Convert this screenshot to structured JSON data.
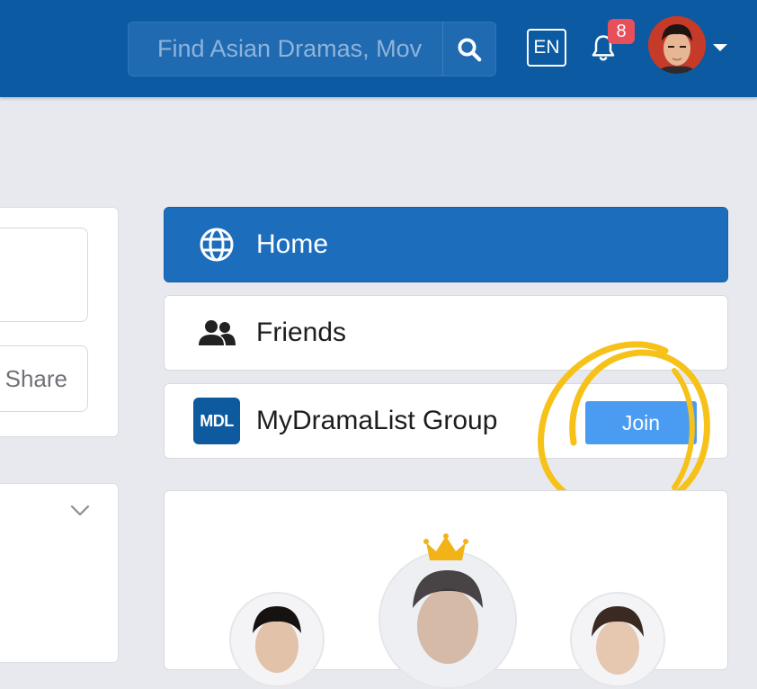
{
  "header": {
    "search": {
      "placeholder": "Find Asian Dramas, Mov",
      "button_icon": "search-icon"
    },
    "language": "EN",
    "notifications": {
      "icon": "bell-icon",
      "count": "8"
    },
    "user_menu": {
      "avatar": "user-avatar",
      "caret_icon": "caret-down-icon"
    }
  },
  "left_panel": {
    "share_label": "Share",
    "collapse_icon": "chevron-down-icon"
  },
  "nav": {
    "items": [
      {
        "label": "Home",
        "icon": "globe-icon",
        "active": true
      },
      {
        "label": "Friends",
        "icon": "users-icon",
        "active": false
      },
      {
        "label": "MyDramaList Group",
        "icon": "mdl-logo",
        "logo_text": "MDL",
        "active": false,
        "action_label": "Join"
      }
    ]
  },
  "colors": {
    "header_bg": "#0b5aa2",
    "active_nav": "#1c6ebd",
    "join_button": "#4a9cf2",
    "badge": "#e74f5a",
    "highlight_annotation": "#f6c21a"
  }
}
